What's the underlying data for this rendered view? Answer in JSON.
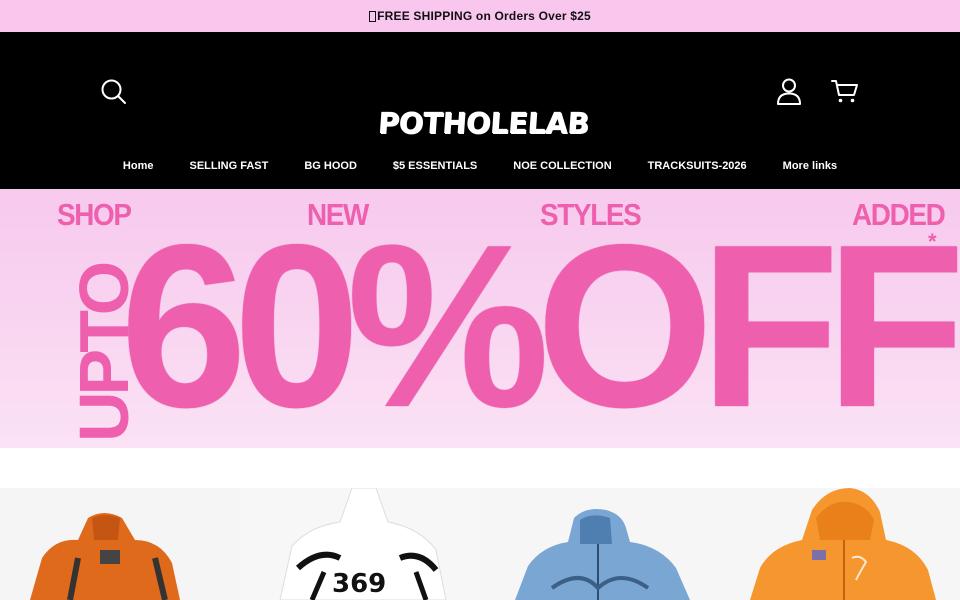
{
  "announcement": {
    "text": "FREE SHIPPING on Orders Over $25"
  },
  "header": {
    "logo_text": "POTHOLELAB",
    "icons": {
      "search": "search-icon",
      "account": "user-icon",
      "cart": "cart-icon"
    }
  },
  "nav": {
    "items": [
      {
        "label": "Home"
      },
      {
        "label": "SELLING FAST"
      },
      {
        "label": "BG HOOD"
      },
      {
        "label": "$5 ESSENTIALS"
      },
      {
        "label": "NOE COLLECTION"
      },
      {
        "label": "TRACKSUITS-2026"
      },
      {
        "label": "More links"
      }
    ]
  },
  "hero": {
    "top_words": [
      "SHOP",
      "NEW",
      "STYLES",
      "ADDED"
    ],
    "side_text": "UPTO",
    "headline": "60%OFF",
    "asterisk": "*"
  },
  "colors": {
    "announce_bg": "#f9c6ee",
    "header_bg": "#000000",
    "hero_pink": "#ee5fae",
    "hero_bg": "#f8cdef"
  },
  "products": [
    {
      "name": "orange hoodie"
    },
    {
      "name": "white graphic hoodie"
    },
    {
      "name": "blue zip hoodie"
    },
    {
      "name": "orange zip hoodie"
    }
  ]
}
